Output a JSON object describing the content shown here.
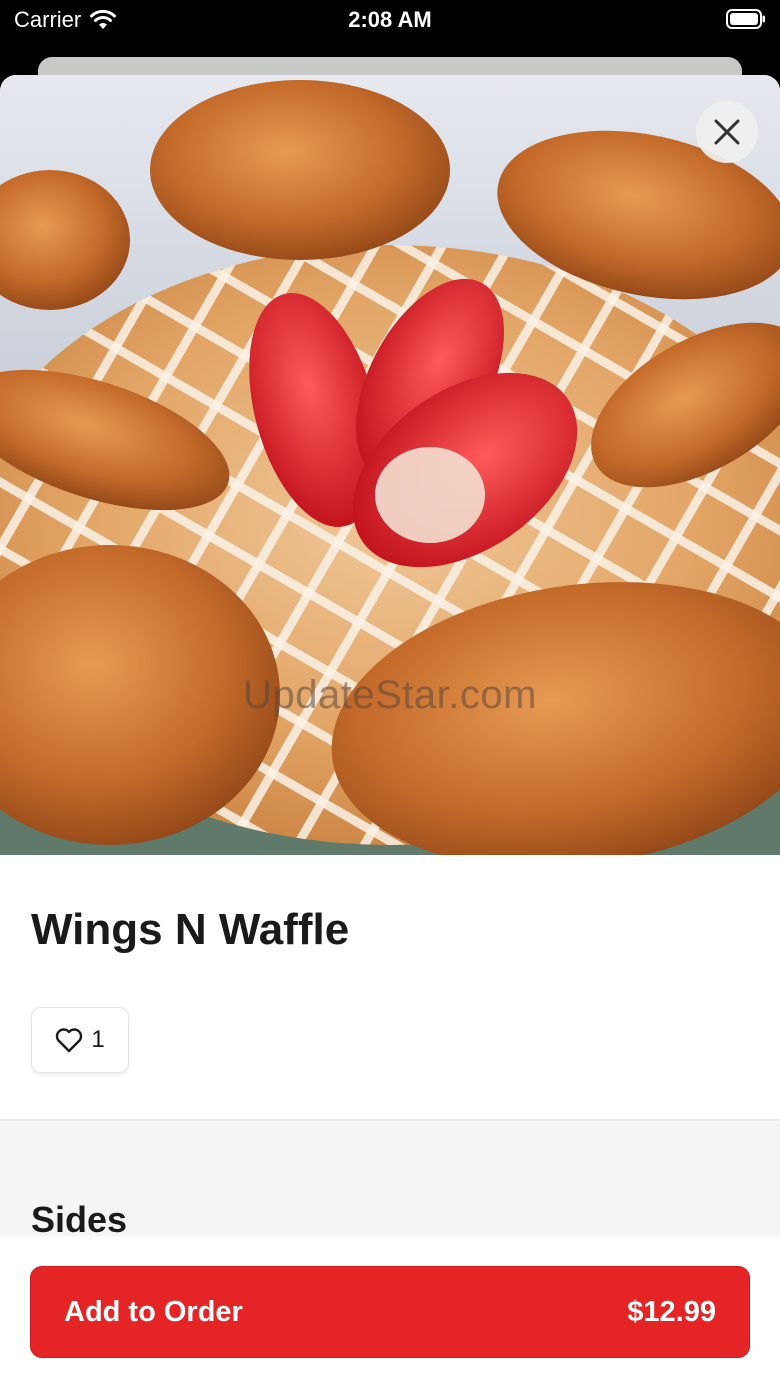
{
  "status_bar": {
    "carrier": "Carrier",
    "time": "2:08 AM",
    "wifi_icon": "wifi-icon",
    "battery_icon": "battery-full-icon"
  },
  "hero": {
    "image_subject": "fried chicken wings on a powdered-sugar waffle with sliced strawberries",
    "watermark": "UpdateStar.com",
    "close_icon": "close-icon"
  },
  "item": {
    "title": "Wings N Waffle",
    "likes": "1",
    "like_icon": "heart-outline-icon"
  },
  "sections": {
    "sides_heading": "Sides"
  },
  "order_button": {
    "label": "Add to Order",
    "price": "$12.99",
    "color": "#e52525"
  }
}
